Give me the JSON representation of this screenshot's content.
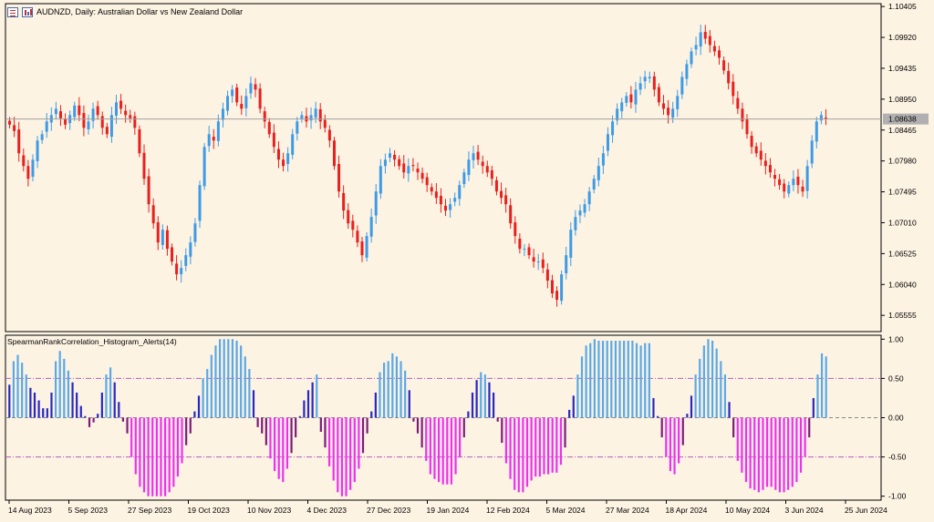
{
  "header": {
    "symbol_title": "AUDNZD, Daily:",
    "symbol_description": "Australian Dollar vs New Zealand Dollar",
    "icons": [
      "chart-bars-icon",
      "chart-candles-icon"
    ]
  },
  "indicator": {
    "title": "SpearmanRankCorrelation_Histogram_Alerts(14)"
  },
  "colors": {
    "background": "#fdf3e3",
    "bull_candle": "#3d9be5",
    "bear_candle": "#e8201e",
    "hist_strong_up": "#5aa9e6",
    "hist_weak_up": "#2828c0",
    "hist_strong_down": "#ee30ee",
    "hist_weak_down": "#7a1d7a",
    "level_line": "#b060c0",
    "price_line": "#a0a0a0",
    "axis": "#000000"
  },
  "chart_data": [
    {
      "type": "candlestick",
      "symbol": "AUDNZD",
      "timeframe": "Daily",
      "ylim": [
        1.053,
        1.1045
      ],
      "y_ticks": [
        "1.10405",
        "1.09920",
        "1.09435",
        "1.08950",
        "1.08465",
        "1.07980",
        "1.07495",
        "1.07010",
        "1.06525",
        "1.06040",
        "1.05555"
      ],
      "current_price": "1.08638",
      "x_ticks": [
        "14 Aug 2023",
        "5 Sep 2023",
        "27 Sep 2023",
        "19 Oct 2023",
        "10 Nov 2023",
        "4 Dec 2023",
        "27 Dec 2023",
        "19 Jan 2024",
        "12 Feb 2024",
        "5 Mar 2024",
        "27 Mar 2024",
        "18 Apr 2024",
        "10 May 2024",
        "3 Jun 2024",
        "25 Jun 2024"
      ],
      "closes": [
        1.0855,
        1.0845,
        1.081,
        1.079,
        1.077,
        1.08,
        1.083,
        1.084,
        1.086,
        1.087,
        1.088,
        1.0865,
        1.0855,
        1.087,
        1.0885,
        1.087,
        1.085,
        1.086,
        1.088,
        1.087,
        1.085,
        1.084,
        1.087,
        1.089,
        1.088,
        1.087,
        1.0865,
        1.085,
        1.081,
        1.077,
        1.073,
        1.07,
        1.067,
        1.069,
        1.066,
        1.064,
        1.062,
        1.063,
        1.065,
        1.067,
        1.07,
        1.076,
        1.082,
        1.084,
        1.083,
        1.086,
        1.088,
        1.09,
        1.091,
        1.089,
        1.088,
        1.09,
        1.092,
        1.091,
        1.088,
        1.086,
        1.084,
        1.082,
        1.08,
        1.079,
        1.081,
        1.084,
        1.086,
        1.087,
        1.086,
        1.087,
        1.088,
        1.086,
        1.085,
        1.083,
        1.079,
        1.075,
        1.072,
        1.07,
        1.069,
        1.067,
        1.065,
        1.068,
        1.071,
        1.075,
        1.079,
        1.08,
        1.081,
        1.08,
        1.079,
        1.078,
        1.079,
        1.079,
        1.078,
        1.077,
        1.076,
        1.075,
        1.074,
        1.073,
        1.072,
        1.073,
        1.074,
        1.076,
        1.078,
        1.08,
        1.081,
        1.08,
        1.079,
        1.078,
        1.077,
        1.075,
        1.074,
        1.073,
        1.07,
        1.068,
        1.066,
        1.066,
        1.065,
        1.064,
        1.064,
        1.063,
        1.061,
        1.059,
        1.058,
        1.062,
        1.065,
        1.069,
        1.071,
        1.072,
        1.073,
        1.075,
        1.077,
        1.079,
        1.081,
        1.084,
        1.086,
        1.088,
        1.089,
        1.09,
        1.089,
        1.091,
        1.092,
        1.093,
        1.093,
        1.091,
        1.089,
        1.088,
        1.087,
        1.088,
        1.09,
        1.093,
        1.095,
        1.097,
        1.098,
        1.1,
        1.099,
        1.098,
        1.097,
        1.096,
        1.094,
        1.092,
        1.09,
        1.088,
        1.086,
        1.084,
        1.082,
        1.081,
        1.08,
        1.079,
        1.078,
        1.077,
        1.076,
        1.075,
        1.076,
        1.077,
        1.076,
        1.075,
        1.079,
        1.083,
        1.086,
        1.087,
        1.0864
      ]
    },
    {
      "type": "histogram",
      "name": "SpearmanRankCorrelation_Histogram_Alerts(14)",
      "ylim": [
        -1.05,
        1.05
      ],
      "y_ticks": [
        "1.00",
        "0.50",
        "0.00",
        "-0.50",
        "-1.00"
      ],
      "levels": [
        0.5,
        -0.5
      ],
      "values": [
        0.42,
        0.72,
        0.8,
        0.7,
        0.55,
        0.38,
        0.32,
        0.22,
        0.12,
        0.12,
        0.32,
        0.72,
        0.85,
        0.75,
        0.6,
        0.45,
        0.32,
        0.15,
        0.02,
        -0.12,
        -0.06,
        0.05,
        0.32,
        0.55,
        0.64,
        0.45,
        0.2,
        -0.05,
        -0.2,
        -0.5,
        -0.72,
        -0.88,
        -0.95,
        -1.0,
        -1.0,
        -1.0,
        -1.0,
        -1.0,
        -0.95,
        -0.88,
        -0.75,
        -0.58,
        -0.35,
        -0.2,
        0.08,
        0.28,
        0.5,
        0.62,
        0.8,
        0.92,
        1.0,
        1.0,
        1.0,
        1.0,
        0.98,
        0.92,
        0.78,
        0.62,
        0.35,
        -0.12,
        -0.2,
        -0.35,
        -0.52,
        -0.68,
        -0.78,
        -0.82,
        -0.65,
        -0.45,
        -0.25,
        0.02,
        0.22,
        0.35,
        0.45,
        0.55,
        -0.18,
        -0.38,
        -0.62,
        -0.8,
        -0.95,
        -1.0,
        -1.0,
        -0.92,
        -0.82,
        -0.65,
        -0.45,
        -0.2,
        0.08,
        0.32,
        0.58,
        0.7,
        0.72,
        0.82,
        0.78,
        0.72,
        0.6,
        0.35,
        -0.05,
        -0.2,
        -0.38,
        -0.55,
        -0.72,
        -0.78,
        -0.82,
        -0.85,
        -0.85,
        -0.85,
        -0.72,
        -0.5,
        -0.25,
        0.08,
        0.32,
        0.48,
        0.58,
        0.55,
        0.45,
        0.32,
        -0.05,
        -0.32,
        -0.58,
        -0.78,
        -0.92,
        -0.95,
        -0.95,
        -0.88,
        -0.8,
        -0.75,
        -0.75,
        -0.72,
        -0.72,
        -0.7,
        -0.7,
        -0.6,
        -0.38,
        0.1,
        0.28,
        0.55,
        0.78,
        0.92,
        0.95,
        1.0,
        0.98,
        0.98,
        0.98,
        0.98,
        0.98,
        0.98,
        0.98,
        0.98,
        0.98,
        0.95,
        0.92,
        0.95,
        0.95,
        0.25,
        0.02,
        -0.25,
        -0.5,
        -0.68,
        -0.72,
        -0.58,
        -0.35,
        0.05,
        0.28,
        0.55,
        0.75,
        0.92,
        1.0,
        0.98,
        0.88,
        0.72,
        0.55,
        0.2,
        -0.25,
        -0.55,
        -0.7,
        -0.82,
        -0.9,
        -0.92,
        -0.95,
        -0.92,
        -0.88,
        -0.88,
        -0.92,
        -0.95,
        -0.95,
        -0.92,
        -0.88,
        -0.82,
        -0.7,
        -0.5,
        -0.25,
        0.25,
        0.55,
        0.82,
        0.78
      ]
    }
  ]
}
